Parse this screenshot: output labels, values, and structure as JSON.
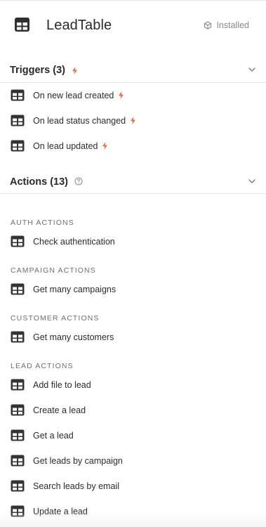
{
  "app": {
    "title": "LeadTable",
    "status": "Installed",
    "icon": "table-icon",
    "status_icon": "cube-icon"
  },
  "triggers": {
    "title": "Triggers (3)",
    "items": [
      {
        "label": "On new lead created",
        "icon": "table-icon",
        "badge": "bolt-icon"
      },
      {
        "label": "On lead status changed",
        "icon": "table-icon",
        "badge": "bolt-icon"
      },
      {
        "label": "On lead updated",
        "icon": "table-icon",
        "badge": "bolt-icon"
      }
    ]
  },
  "actions": {
    "title": "Actions (13)",
    "help_icon": "help-circle-icon",
    "groups": [
      {
        "label": "AUTH ACTIONS",
        "items": [
          {
            "label": "Check authentication"
          }
        ]
      },
      {
        "label": "CAMPAIGN ACTIONS",
        "items": [
          {
            "label": "Get many campaigns"
          }
        ]
      },
      {
        "label": "CUSTOMER ACTIONS",
        "items": [
          {
            "label": "Get many customers"
          }
        ]
      },
      {
        "label": "LEAD ACTIONS",
        "items": [
          {
            "label": "Add file to lead"
          },
          {
            "label": "Create a lead"
          },
          {
            "label": "Get a lead"
          },
          {
            "label": "Get leads by campaign"
          },
          {
            "label": "Search leads by email"
          },
          {
            "label": "Update a lead"
          }
        ]
      }
    ]
  },
  "colors": {
    "accent_bolt": "#ef6a3a",
    "icon_dark": "#2f2f2f",
    "muted": "#8a8a8a",
    "divider": "#e3e3e3"
  }
}
